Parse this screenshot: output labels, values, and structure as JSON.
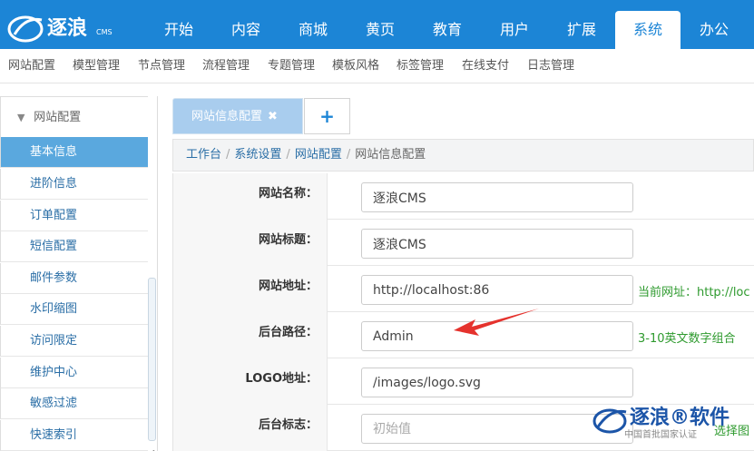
{
  "brand": {
    "logo_text": "逐浪",
    "logo_tag": "CMS",
    "accent": "#1c85d6"
  },
  "topnav": {
    "items": [
      {
        "label": "开始"
      },
      {
        "label": "内容"
      },
      {
        "label": "商城"
      },
      {
        "label": "黄页"
      },
      {
        "label": "教育"
      },
      {
        "label": "用户"
      },
      {
        "label": "扩展"
      },
      {
        "label": "系统",
        "active": true
      },
      {
        "label": "办公"
      }
    ]
  },
  "subnav": {
    "items": [
      {
        "label": "网站配置"
      },
      {
        "label": "模型管理"
      },
      {
        "label": "节点管理"
      },
      {
        "label": "流程管理"
      },
      {
        "label": "专题管理"
      },
      {
        "label": "模板风格"
      },
      {
        "label": "标签管理"
      },
      {
        "label": "在线支付"
      },
      {
        "label": "日志管理"
      }
    ]
  },
  "sidebar": {
    "group_label": "网站配置",
    "items": [
      {
        "label": "基本信息",
        "active": true
      },
      {
        "label": "进阶信息"
      },
      {
        "label": "订单配置"
      },
      {
        "label": "短信配置"
      },
      {
        "label": "邮件参数"
      },
      {
        "label": "水印缩图"
      },
      {
        "label": "访问限定"
      },
      {
        "label": "维护中心"
      },
      {
        "label": "敏感过滤"
      },
      {
        "label": "快速索引"
      }
    ]
  },
  "tabs": {
    "active_label": "网站信息配置",
    "close_glyph": "✖",
    "add_glyph": "+"
  },
  "breadcrumb": {
    "items": [
      "工作台",
      "系统设置",
      "网站配置",
      "网站信息配置"
    ],
    "separator": "/"
  },
  "form": {
    "rows": [
      {
        "label": "网站名称：",
        "value": "逐浪CMS",
        "placeholder": "",
        "hint": ""
      },
      {
        "label": "网站标题：",
        "value": "逐浪CMS",
        "placeholder": "",
        "hint": ""
      },
      {
        "label": "网站地址：",
        "value": "http://localhost:86",
        "placeholder": "",
        "hint": "当前网址：http://loc"
      },
      {
        "label": "后台路径：",
        "value": "Admin",
        "placeholder": "",
        "hint": "3-10英文数字组合"
      },
      {
        "label": "LOGO地址：",
        "value": "/images/logo.svg",
        "placeholder": "",
        "hint": ""
      },
      {
        "label": "后台标志：",
        "value": "",
        "placeholder": "初始值",
        "hint": "选择图"
      }
    ]
  },
  "watermark": {
    "title": "逐浪®软件",
    "subtitle": "中国首批国家认证"
  },
  "colors": {
    "hint_green": "#2e9a2e",
    "arrow_red": "#e5322d",
    "link_blue": "#2a6ea6"
  }
}
